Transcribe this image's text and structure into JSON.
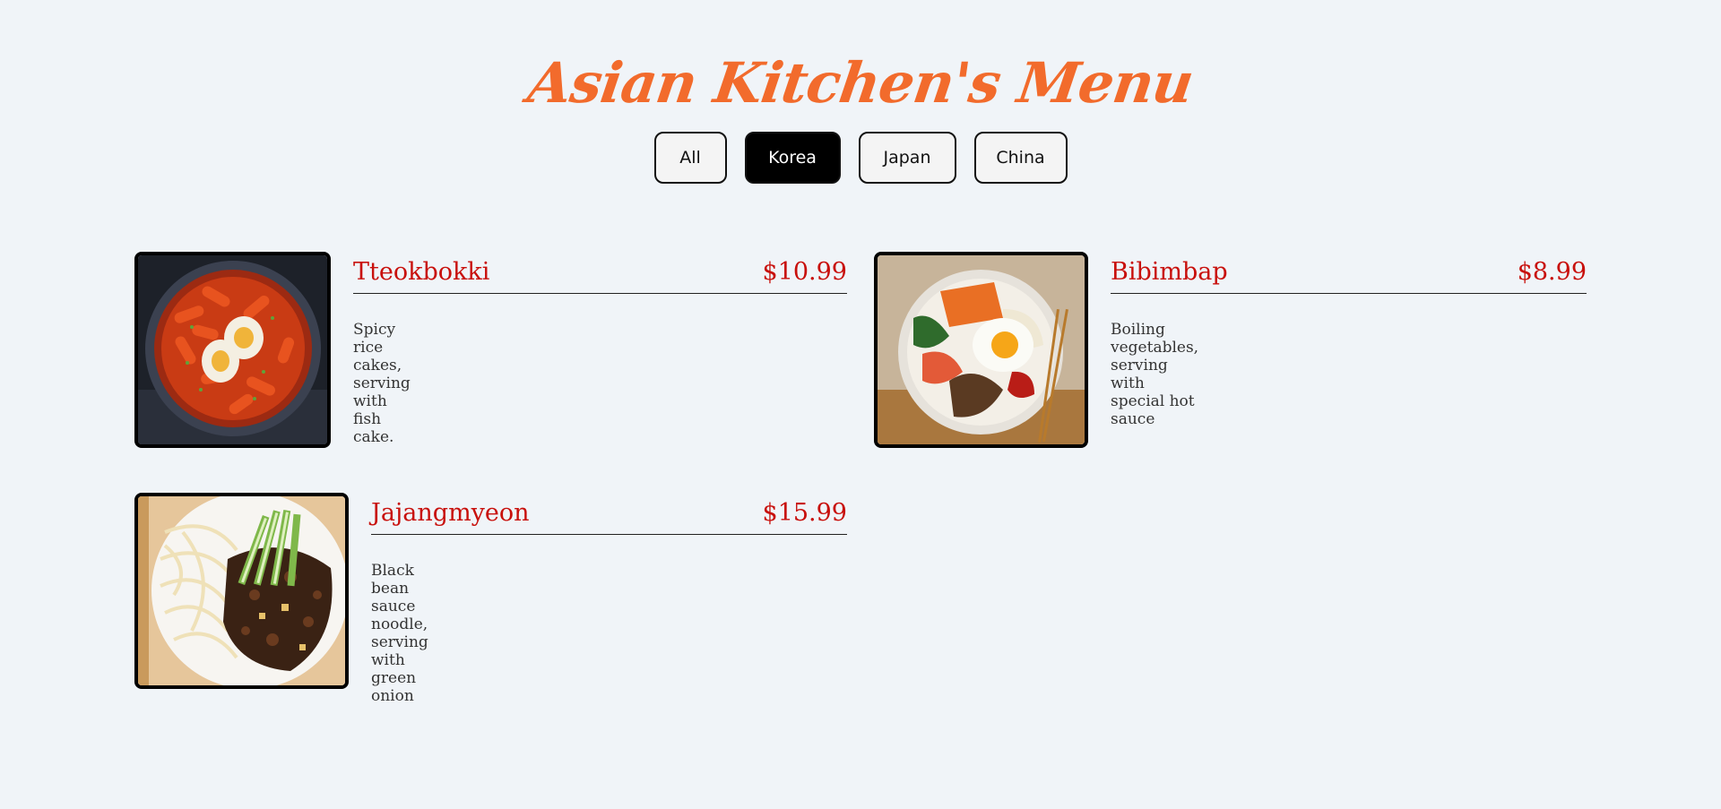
{
  "page": {
    "title": "Asian Kitchen's Menu",
    "accent_color": "#f26b2c",
    "price_color": "#c8100c",
    "background": "#f0f4f8"
  },
  "filters": {
    "active": "Korea",
    "items": [
      {
        "label": "All"
      },
      {
        "label": "Korea"
      },
      {
        "label": "Japan"
      },
      {
        "label": "China"
      }
    ]
  },
  "menu": {
    "items": [
      {
        "name": "Tteokbokki",
        "price": "$10.99",
        "description": "Spicy rice cakes, serving with fish cake.",
        "photo": "tteokbokki-photo"
      },
      {
        "name": "Bibimbap",
        "price": "$8.99",
        "description": "Boiling vegetables, serving with special hot sauce",
        "photo": "bibimbap-photo"
      },
      {
        "name": "Jajangmyeon",
        "price": "$15.99",
        "description": "Black bean sauce noodle, serving with green onion",
        "photo": "jajangmyeon-photo"
      }
    ]
  }
}
